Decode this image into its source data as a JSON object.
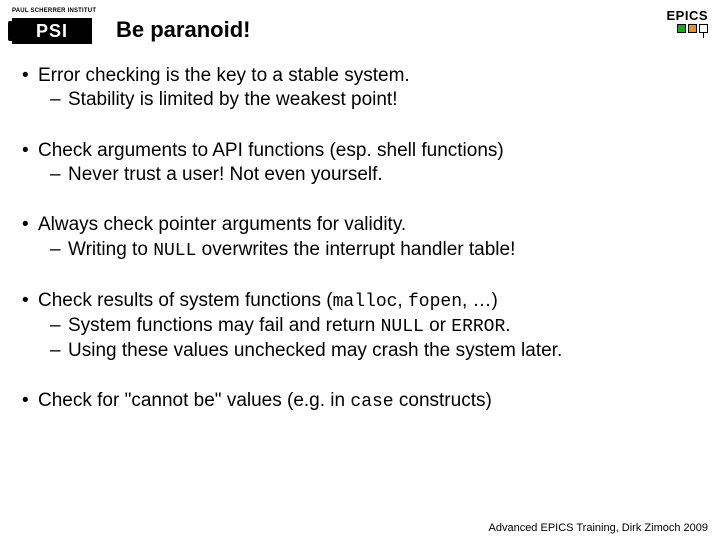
{
  "header": {
    "psi_tagline": "PAUL SCHERRER INSTITUT",
    "psi_text": "PSI",
    "title": "Be paranoid!",
    "epics_text": "EPICS"
  },
  "bullets": [
    {
      "text": "Error checking is the key to a stable system.",
      "subs": [
        {
          "text": "Stability is limited by the weakest point!"
        }
      ]
    },
    {
      "text": "Check arguments to API functions (esp. shell functions)",
      "subs": [
        {
          "text": "Never trust a user! Not even yourself."
        }
      ]
    },
    {
      "text": "Always check pointer arguments for validity.",
      "subs": [
        {
          "pre": "Writing to ",
          "code": "NULL",
          "post": " overwrites the interrupt handler table!"
        }
      ]
    },
    {
      "pre": "Check results of system functions (",
      "code": "malloc",
      "mid1": ", ",
      "code2": "fopen",
      "post": ", …)",
      "subs": [
        {
          "pre": "System functions may fail and return ",
          "code": "NULL",
          "mid1": " or ",
          "code2": "ERROR",
          "post": "."
        },
        {
          "text": "Using these values unchecked may crash the system later."
        }
      ]
    },
    {
      "pre": "Check for \"cannot be\" values (e.g. in ",
      "code": "case",
      "post": " constructs)",
      "subs": []
    }
  ],
  "footer": "Advanced EPICS Training, Dirk Zimoch 2009"
}
